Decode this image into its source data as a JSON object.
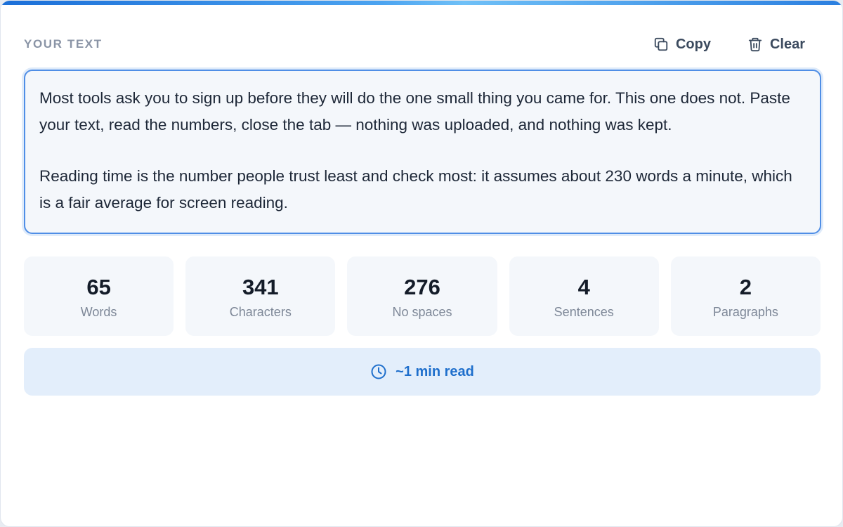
{
  "header": {
    "section_label": "YOUR TEXT",
    "copy_label": "Copy",
    "clear_label": "Clear"
  },
  "editor": {
    "paragraphs": [
      "Most tools ask you to sign up before they will do the one small thing you came for. This one does not. Paste your text, read the numbers, close the tab — nothing was uploaded, and nothing was kept.",
      "Reading time is the number people trust least and check most: it assumes about 230 words a minute, which is a fair average for screen reading."
    ]
  },
  "stats": [
    {
      "value": "65",
      "label": "Words"
    },
    {
      "value": "341",
      "label": "Characters"
    },
    {
      "value": "276",
      "label": "No spaces"
    },
    {
      "value": "4",
      "label": "Sentences"
    },
    {
      "value": "2",
      "label": "Paragraphs"
    }
  ],
  "reading": {
    "label": "~1 min read",
    "icon": "clock-icon"
  },
  "icons": {
    "copy": "copy-icon",
    "clear": "trash-icon"
  },
  "colors": {
    "accent": "#1f6fcc",
    "focus_border": "#4f8ee6",
    "panel_bg": "#f4f7fb",
    "reading_bg": "#e3eefb"
  }
}
